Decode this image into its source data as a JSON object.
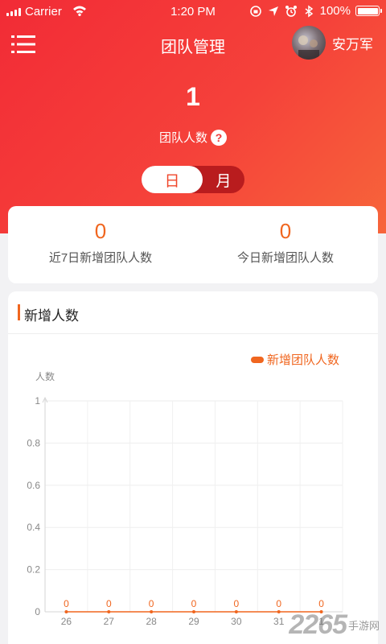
{
  "status_bar": {
    "carrier": "Carrier",
    "time": "1:20 PM",
    "battery": "100%"
  },
  "nav": {
    "title": "团队管理",
    "user_name": "安万军"
  },
  "summary": {
    "team_count": "1",
    "team_label": "团队人数",
    "help": "?"
  },
  "toggle": {
    "day": "日",
    "month": "月",
    "selected": "日"
  },
  "stats": [
    {
      "value": "0",
      "label": "近7日新增团队人数"
    },
    {
      "value": "0",
      "label": "今日新增团队人数"
    }
  ],
  "chart_section": {
    "title": "新增人数"
  },
  "chart_data": {
    "type": "line",
    "ylabel": "人数",
    "ylim": [
      0,
      1
    ],
    "y_ticks": [
      "0",
      "0.2",
      "0.4",
      "0.6",
      "0.8",
      "1"
    ],
    "categories": [
      "26",
      "27",
      "28",
      "29",
      "30",
      "31",
      "1"
    ],
    "series": [
      {
        "name": "新增团队人数",
        "values": [
          0,
          0,
          0,
          0,
          0,
          0,
          0
        ],
        "color": "#f0661f"
      }
    ],
    "legend": "top-right",
    "grid": true
  },
  "watermark": {
    "brand": "2265",
    "suffix": "手游网"
  }
}
